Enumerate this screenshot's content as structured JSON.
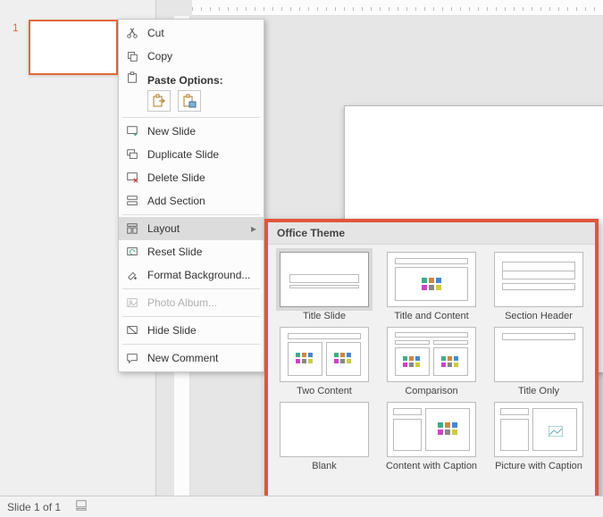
{
  "slide_num": "1",
  "statusbar": {
    "text": "Slide 1 of 1"
  },
  "context_menu": {
    "cut": "Cut",
    "copy": "Copy",
    "paste_section": "Paste Options:",
    "new_slide": "New Slide",
    "duplicate_slide": "Duplicate Slide",
    "delete_slide": "Delete Slide",
    "add_section": "Add Section",
    "layout": "Layout",
    "reset_slide": "Reset Slide",
    "format_background": "Format Background...",
    "photo_album": "Photo Album...",
    "hide_slide": "Hide Slide",
    "new_comment": "New Comment"
  },
  "flyout": {
    "header": "Office Theme",
    "layouts": {
      "title_slide": "Title Slide",
      "title_and_content": "Title and Content",
      "section_header": "Section Header",
      "two_content": "Two Content",
      "comparison": "Comparison",
      "title_only": "Title Only",
      "blank": "Blank",
      "content_with_caption": "Content with Caption",
      "picture_with_caption": "Picture with Caption"
    }
  }
}
